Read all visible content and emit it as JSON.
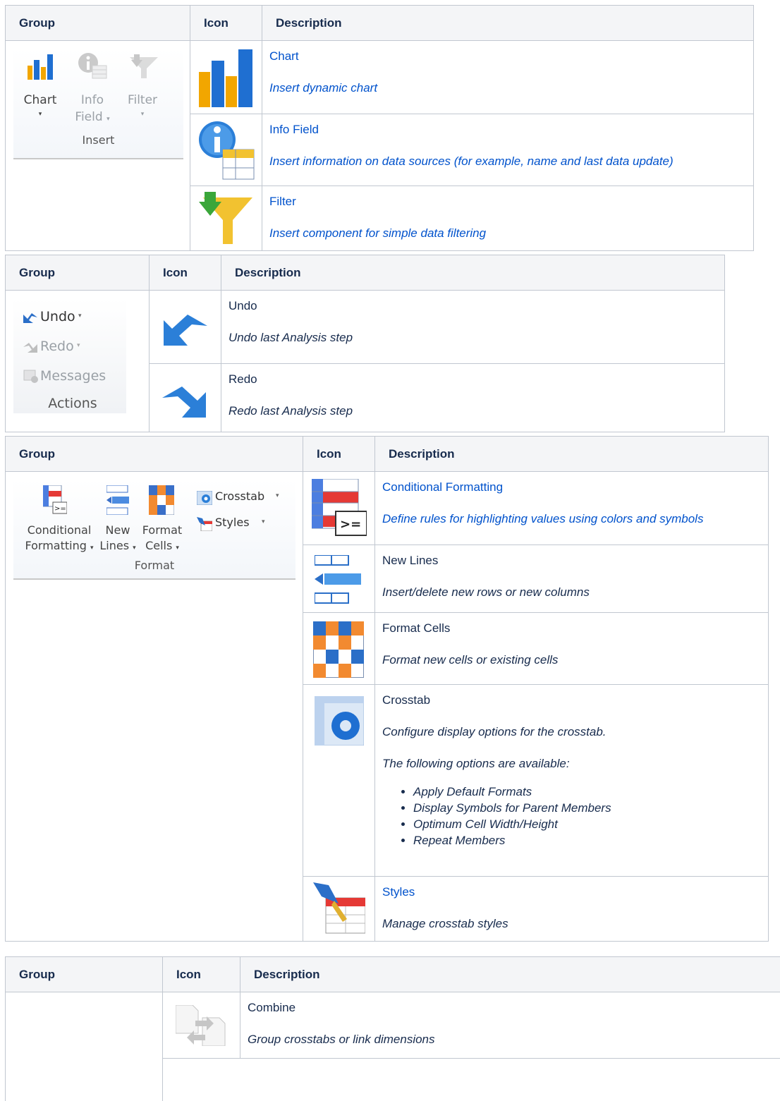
{
  "tables": [
    {
      "headers": {
        "group": "Group",
        "icon": "Icon",
        "description": "Description"
      },
      "ribbon": {
        "buttons": [
          {
            "label": "Chart",
            "caret": "▾"
          },
          {
            "label": "Info",
            "label2": "Field",
            "caret": "▾"
          },
          {
            "label": "Filter",
            "caret": "▾"
          }
        ],
        "group_title": "Insert"
      },
      "rows": [
        {
          "title": "Chart",
          "desc": "Insert dynamic chart"
        },
        {
          "title": "Info Field",
          "desc": "Insert information on data sources (for example, name and last data update)"
        },
        {
          "title": "Filter",
          "desc": "Insert component for simple data filtering"
        }
      ]
    },
    {
      "headers": {
        "group": "Group",
        "icon": "Icon",
        "description": "Description"
      },
      "ribbon": {
        "items": [
          {
            "label": "Undo",
            "caret": "▾"
          },
          {
            "label": "Redo",
            "caret": "▾"
          },
          {
            "label": "Messages"
          }
        ],
        "group_title": "Actions"
      },
      "rows": [
        {
          "title": "Undo",
          "desc": "Undo last Analysis step"
        },
        {
          "title": "Redo",
          "desc": "Redo last Analysis step"
        }
      ]
    },
    {
      "headers": {
        "group": "Group",
        "icon": "Icon",
        "description": "Description"
      },
      "ribbon": {
        "buttons": [
          {
            "label": "Conditional",
            "label2": "Formatting",
            "caret": "▾"
          },
          {
            "label": "New",
            "label2": "Lines",
            "caret": "▾"
          },
          {
            "label": "Format",
            "label2": "Cells",
            "caret": "▾"
          }
        ],
        "small": [
          {
            "label": "Crosstab",
            "caret": "▾"
          },
          {
            "label": "Styles",
            "caret": "▾"
          }
        ],
        "group_title": "Format"
      },
      "rows": [
        {
          "title": "Conditional Formatting",
          "desc": "Define rules for highlighting values using colors and symbols"
        },
        {
          "title": "New Lines",
          "desc": "Insert/delete new rows or new columns"
        },
        {
          "title": "Format Cells",
          "desc": "Format new cells or existing cells"
        },
        {
          "title": "Crosstab",
          "desc": "Configure display options for the crosstab.",
          "desc2": "The following options are available:",
          "options": [
            "Apply Default Formats",
            "Display Symbols for Parent Members",
            "Optimum Cell Width/Height",
            "Repeat Members"
          ]
        },
        {
          "title": "Styles",
          "desc": "Manage crosstab styles"
        }
      ]
    },
    {
      "headers": {
        "group": "Group",
        "icon": "Icon",
        "description": "Description"
      },
      "rows": [
        {
          "title": "Combine",
          "desc": "Group crosstabs or link dimensions"
        }
      ]
    }
  ],
  "colors": {
    "link": "#0052cc",
    "text": "#172b4d",
    "border": "#c1c7d0",
    "header_bg": "#f4f5f7"
  }
}
